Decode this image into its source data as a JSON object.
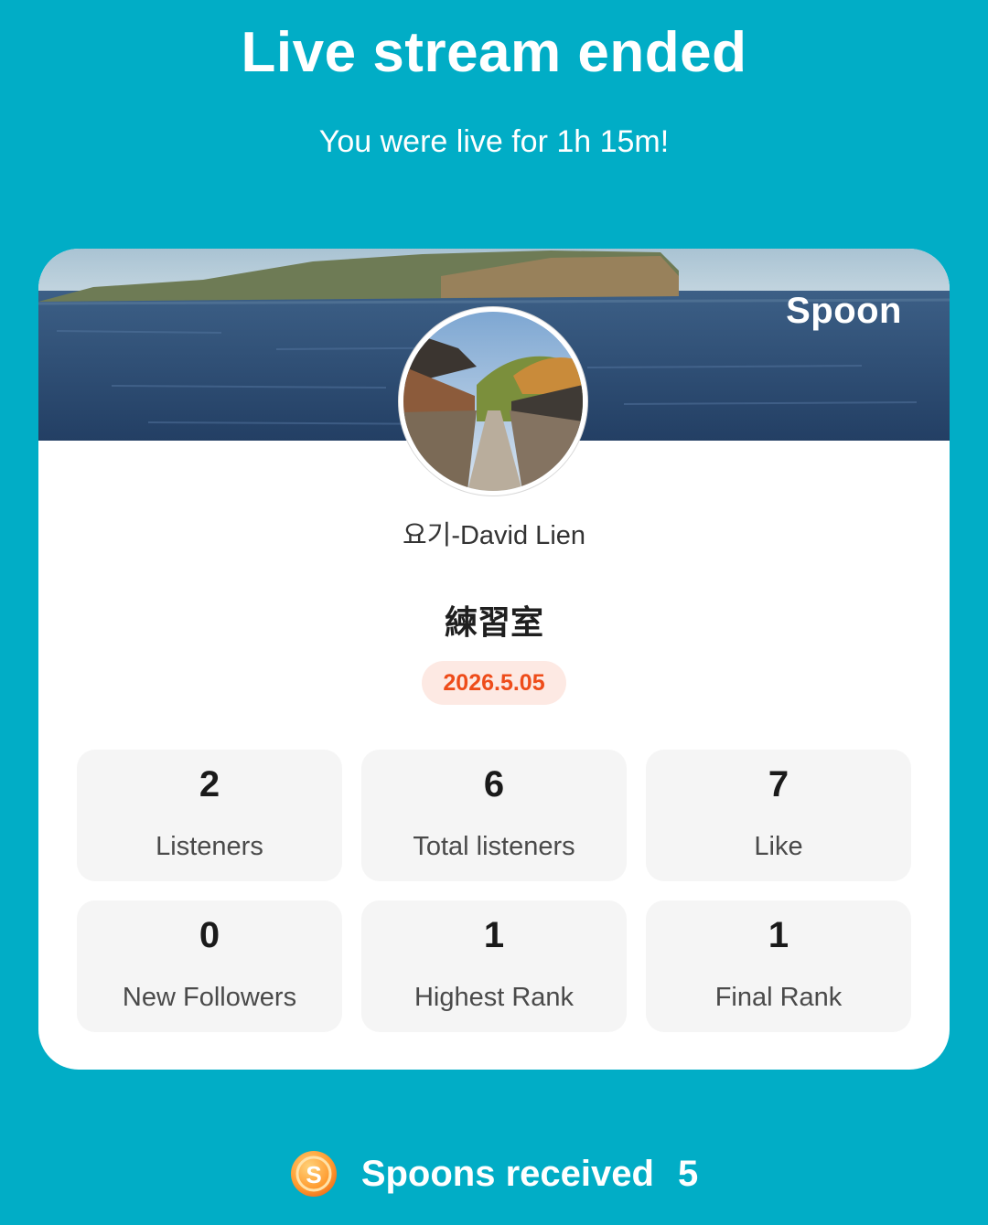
{
  "header": {
    "title": "Live stream ended",
    "subtitle": "You were live for 1h 15m!"
  },
  "card": {
    "brand": "Spoon",
    "username": "요기-David Lien",
    "room_title": "練習室",
    "date": "2026.5.05",
    "stats": [
      {
        "value": "2",
        "label": "Listeners"
      },
      {
        "value": "6",
        "label": "Total listeners"
      },
      {
        "value": "7",
        "label": "Like"
      },
      {
        "value": "0",
        "label": "New Followers"
      },
      {
        "value": "1",
        "label": "Highest Rank"
      },
      {
        "value": "1",
        "label": "Final Rank"
      }
    ]
  },
  "footer": {
    "label": "Spoons received",
    "count": "5",
    "coin_letter": "S",
    "coin_icon": "spoon-coin-icon"
  },
  "colors": {
    "background": "#01adc6",
    "date_badge_bg": "#fde9e3",
    "date_badge_text": "#ee4c1a",
    "stat_tile_bg": "#f5f5f5"
  }
}
